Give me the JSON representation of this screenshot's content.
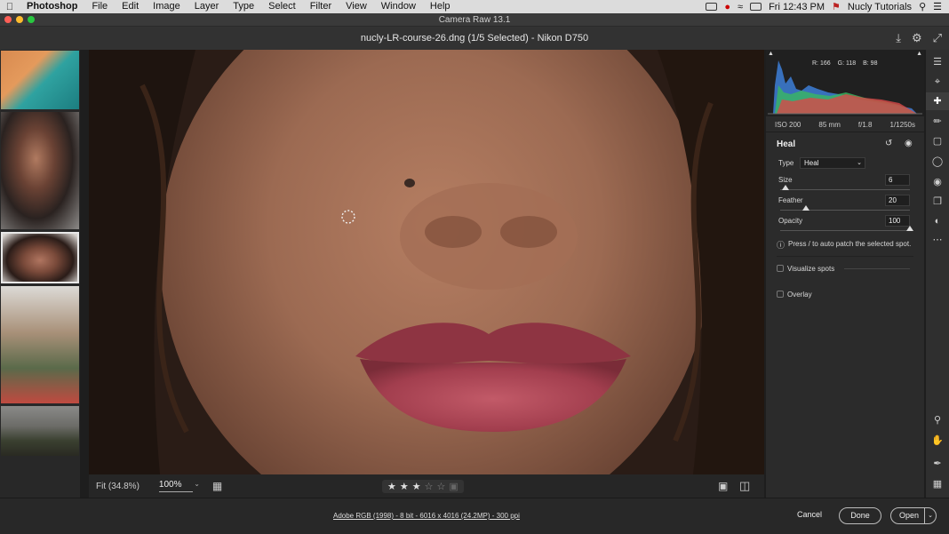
{
  "menubar": {
    "app_name": "Photoshop",
    "items": [
      "File",
      "Edit",
      "Image",
      "Layer",
      "Type",
      "Select",
      "Filter",
      "View",
      "Window",
      "Help"
    ],
    "clock": "Fri 12:43 PM",
    "user": "Nucly Tutorials"
  },
  "window": {
    "title": "Camera Raw 13.1",
    "file_title": "nucly-LR-course-26.dng (1/5 Selected)  -  Nikon D750"
  },
  "histogram": {
    "readout": {
      "r": "R: 166",
      "g": "G: 118",
      "b": "B: 98"
    }
  },
  "meta": {
    "iso": "ISO 200",
    "focal": "85 mm",
    "aperture": "f/1.8",
    "shutter": "1/1250s"
  },
  "panel": {
    "title": "Heal",
    "type_label": "Type",
    "type_value": "Heal",
    "size_label": "Size",
    "size_value": "6",
    "size_level": 0.04,
    "feather_label": "Feather",
    "feather_value": "20",
    "feather_level": 0.2,
    "opacity_label": "Opacity",
    "opacity_value": "100",
    "opacity_level": 1.0,
    "hint": "Press / to auto patch the selected spot.",
    "visualize_label": "Visualize spots",
    "overlay_label": "Overlay"
  },
  "bottombar": {
    "fit_label": "Fit (34.8%)",
    "zoom_value": "100%",
    "rating": 3,
    "rating_max": 5
  },
  "footer": {
    "info": "Adobe RGB (1998) - 8 bit - 6016 x 4016 (24.2MP) - 300 ppi",
    "cancel": "Cancel",
    "done": "Done",
    "open": "Open"
  },
  "colors": {
    "accent": "#ffffff",
    "panel_bg": "#2b2b2b"
  }
}
